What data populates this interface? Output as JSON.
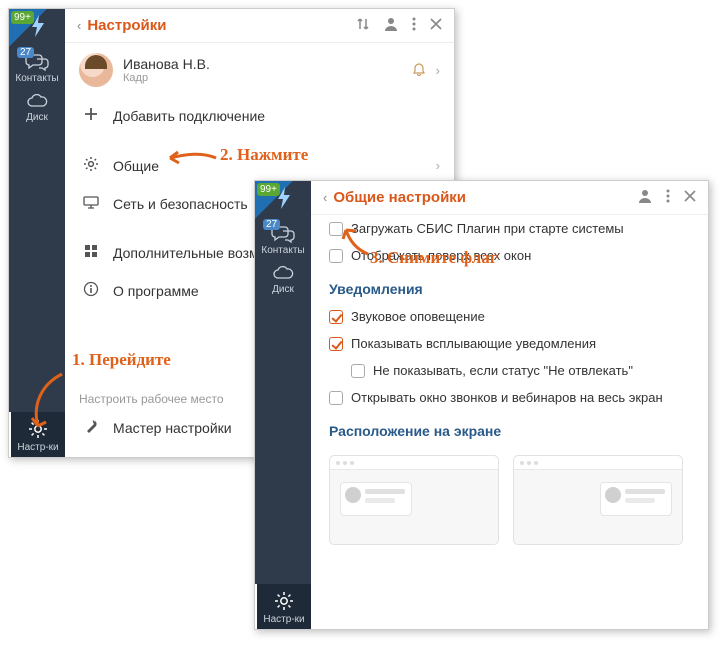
{
  "sidebar": {
    "badge99": "99+",
    "contacts": {
      "label": "Контакты",
      "badge": "27"
    },
    "disk": {
      "label": "Диск"
    },
    "settings": {
      "label": "Настр-ки"
    }
  },
  "settingsWindow": {
    "title": "Настройки",
    "user": {
      "name": "Иванова Н.В.",
      "sub": "Кадр"
    },
    "addConnection": "Добавить подключение",
    "general": "Общие",
    "network": "Сеть и безопасность",
    "additional": "Дополнительные возможности",
    "about": "О программе",
    "workplaceHint": "Настроить рабочее место",
    "wizard": "Мастер настройки"
  },
  "generalWindow": {
    "title": "Общие настройки",
    "loadOnStart": "Загружать СБИС Плагин при старте системы",
    "alwaysOnTop": "Отображать поверх всех окон",
    "notificationsTitle": "Уведомления",
    "sound": "Звуковое оповещение",
    "popup": "Показывать всплывающие уведомления",
    "dnd": "Не показывать, если статус \"Не отвлекать\"",
    "fullscreenCalls": "Открывать окно звонков и вебинаров на весь экран",
    "screenPosTitle": "Расположение на экране"
  },
  "annotations": {
    "a1": "1. Перейдите",
    "a2": "2. Нажмите",
    "a3": "3. Снимите флаг"
  }
}
